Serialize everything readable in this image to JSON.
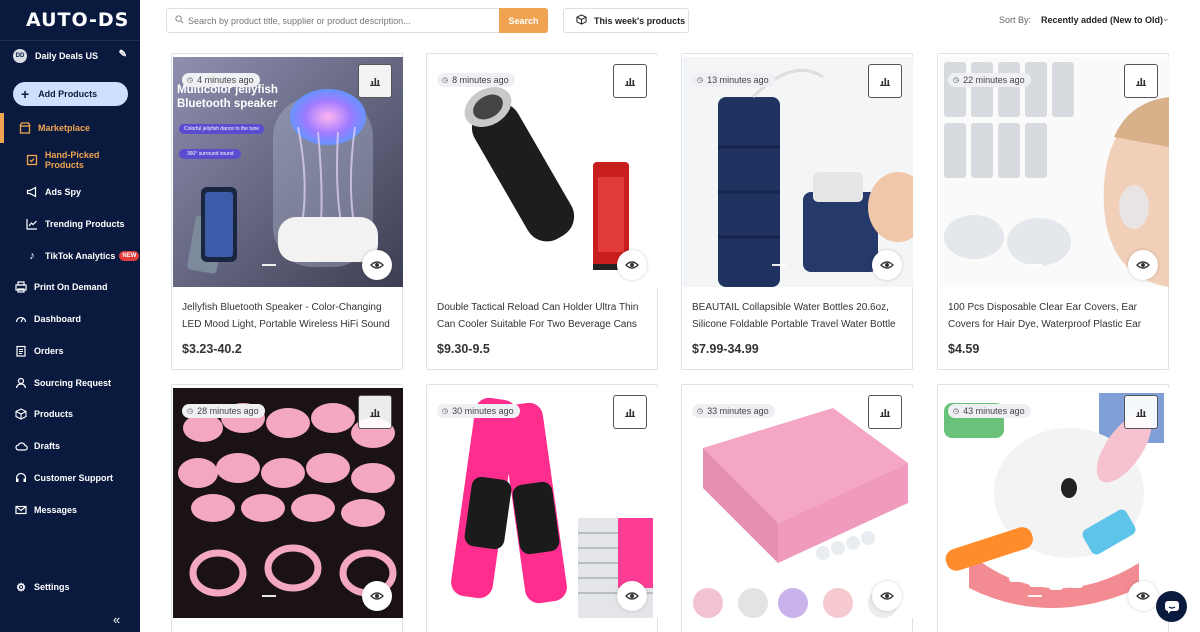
{
  "brand": "AUTO-DS",
  "store": {
    "avatar": "DD",
    "name": "Daily Deals US"
  },
  "sidebar": {
    "add_products": "Add Products",
    "items": [
      {
        "label": "Marketplace"
      },
      {
        "label": "Hand-Picked Products"
      },
      {
        "label": "Ads Spy"
      },
      {
        "label": "Trending Products"
      },
      {
        "label": "TikTok Analytics",
        "badge": "NEW"
      },
      {
        "label": "Print On Demand"
      },
      {
        "label": "Dashboard"
      },
      {
        "label": "Orders"
      },
      {
        "label": "Sourcing Request"
      },
      {
        "label": "Products"
      },
      {
        "label": "Drafts"
      },
      {
        "label": "Customer Support"
      },
      {
        "label": "Messages"
      },
      {
        "label": "Settings"
      }
    ],
    "collapse": "«"
  },
  "topbar": {
    "search_placeholder": "Search by product title, supplier or product description...",
    "search_button": "Search",
    "week_button": "This week's products",
    "sort_label": "Sort By:",
    "sort_value": "Recently added (New to Old)"
  },
  "products": [
    {
      "time": "4 minutes ago",
      "title": "Jellyfish Bluetooth Speaker - Color-Changing LED Mood Light, Portable Wireless HiFi Sound",
      "price": "$3.23-40.2",
      "img_text": "Multicolor jellyfish Bluetooth speaker",
      "img_pill1": "Colorful jellyfish dance to the tune",
      "img_pill2": "360° surround sound"
    },
    {
      "time": "8 minutes ago",
      "title": "Double Tactical Reload Can Holder Ultra Thin Can Cooler Suitable For Two Beverage Cans",
      "price": "$9.30-9.5"
    },
    {
      "time": "13 minutes ago",
      "title": "BEAUTAIL Collapsible Water Bottles 20.6oz, Silicone Foldable Portable Travel Water Bottle",
      "price": "$7.99-34.99"
    },
    {
      "time": "22 minutes ago",
      "title": "100 Pcs Disposable Clear Ear Covers, Ear Covers for Hair Dye, Waterproof Plastic Ear",
      "price": "$4.59"
    },
    {
      "time": "28 minutes ago"
    },
    {
      "time": "30 minutes ago"
    },
    {
      "time": "33 minutes ago"
    },
    {
      "time": "43 minutes ago"
    }
  ],
  "colors": {
    "sidebar": "#0a1a3f",
    "accent": "#f0a451",
    "active_button": "#cfe0ff",
    "new_badge": "#e23b3b"
  },
  "icons": [
    "clock-icon",
    "bar-chart-icon",
    "eye-icon",
    "chat-icon"
  ]
}
